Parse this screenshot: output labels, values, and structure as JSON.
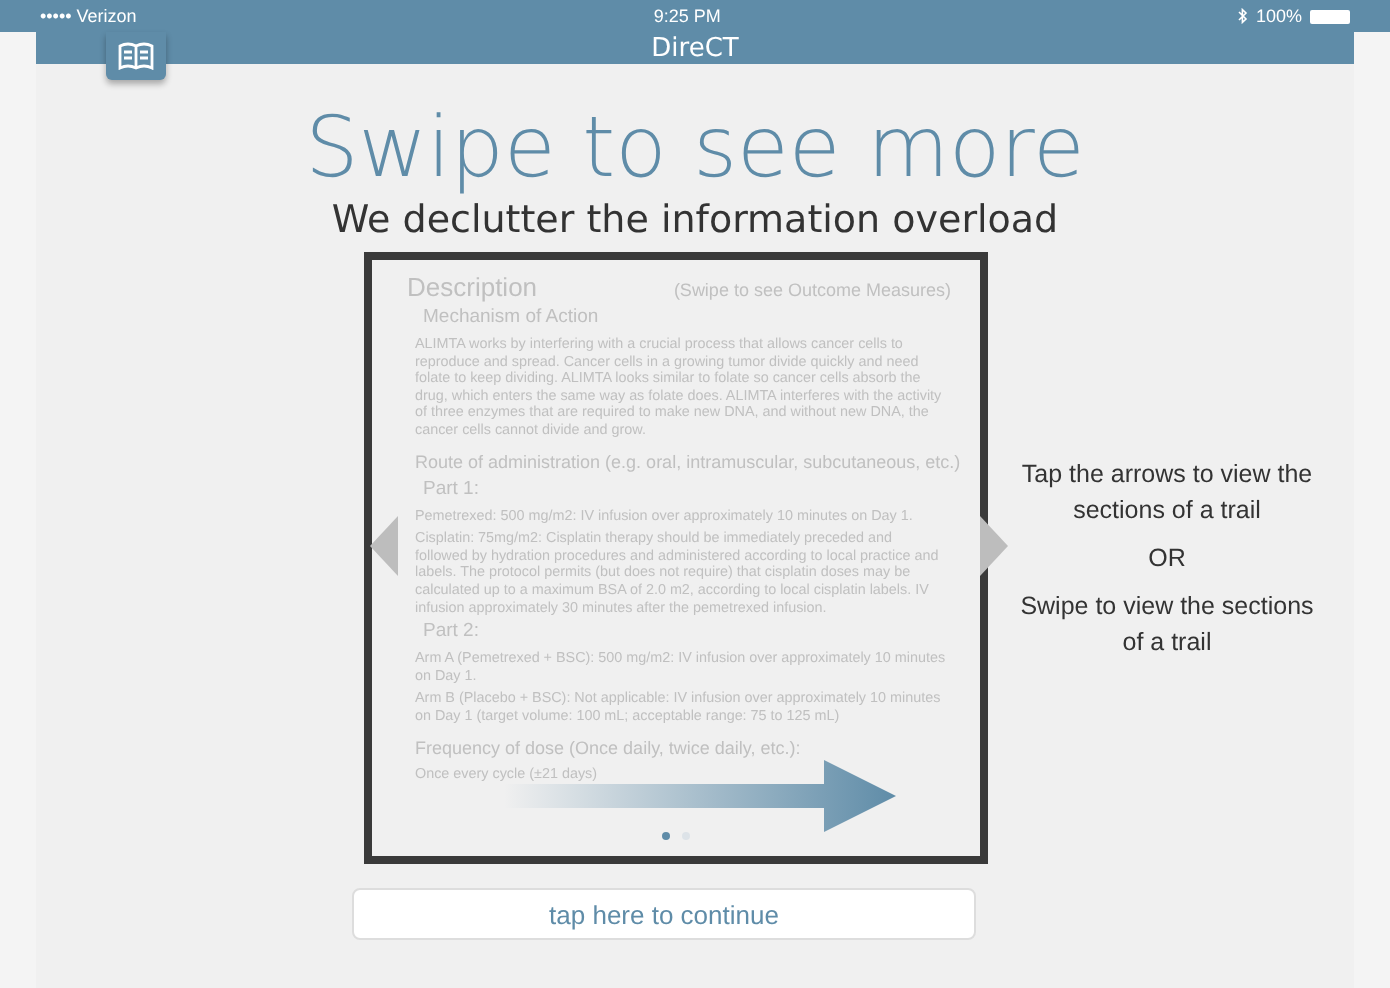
{
  "status_bar": {
    "carrier": "••••• Verizon",
    "time": "9:25 PM",
    "battery": "100%"
  },
  "nav_bar": {
    "title": "DireCT"
  },
  "heading": "Swipe to see more",
  "subheading": "We declutter the information overload",
  "card": {
    "title": "Description",
    "hint": "(Swipe to see Outcome Measures)",
    "blocks": [
      {
        "kind": "subheading",
        "text": "Mechanism of Action"
      },
      {
        "kind": "paragraph",
        "text": "ALIMTA works by interfering with a crucial process that allows cancer cells to reproduce and spread. Cancer cells in a growing tumor divide quickly and need folate to keep dividing. ALIMTA looks similar to folate so cancer cells absorb the drug, which enters the same way as folate does.  ALIMTA interferes with the activity of three enzymes that are required to make new DNA, and without new DNA, the cancer cells cannot divide and grow."
      },
      {
        "kind": "section",
        "text": "Route of administration (e.g. oral, intramuscular, subcutaneous, etc.)"
      },
      {
        "kind": "subheading",
        "text": "Part 1:"
      },
      {
        "kind": "paragraph",
        "text": "Pemetrexed: 500 mg/m2: IV infusion over approximately 10 minutes on Day 1."
      },
      {
        "kind": "paragraph",
        "text": "Cisplatin: 75mg/m2: Cisplatin therapy should be immediately preceded and followed by hydration procedures and administered according to local practice and labels. The protocol permits (but does not require) that cisplatin doses may be calculated up to a maximum BSA of 2.0 m2, according to local cisplatin labels. IV infusion approximately 30 minutes after the pemetrexed infusion."
      },
      {
        "kind": "subheading",
        "text": "Part 2:"
      },
      {
        "kind": "paragraph",
        "text": "Arm A (Pemetrexed + BSC): 500 mg/m2: IV infusion over approximately 10 minutes on Day 1."
      },
      {
        "kind": "paragraph",
        "text": "Arm B (Placebo + BSC): Not applicable: IV infusion over approximately 10 minutes on Day 1 (target volume: 100 mL; acceptable range: 75 to 125 mL)"
      },
      {
        "kind": "section",
        "text": "Frequency of dose (Once daily, twice daily, etc.):"
      },
      {
        "kind": "paragraph",
        "text": "Once every cycle (±21 days)"
      }
    ],
    "pages": [
      {
        "selected": true
      },
      {
        "selected": false
      }
    ]
  },
  "side_notes": [
    "Tap the arrows to view the sections of a trail",
    "OR",
    "Swipe to view the sections of a trail"
  ],
  "continue_button": "tap here to continue"
}
